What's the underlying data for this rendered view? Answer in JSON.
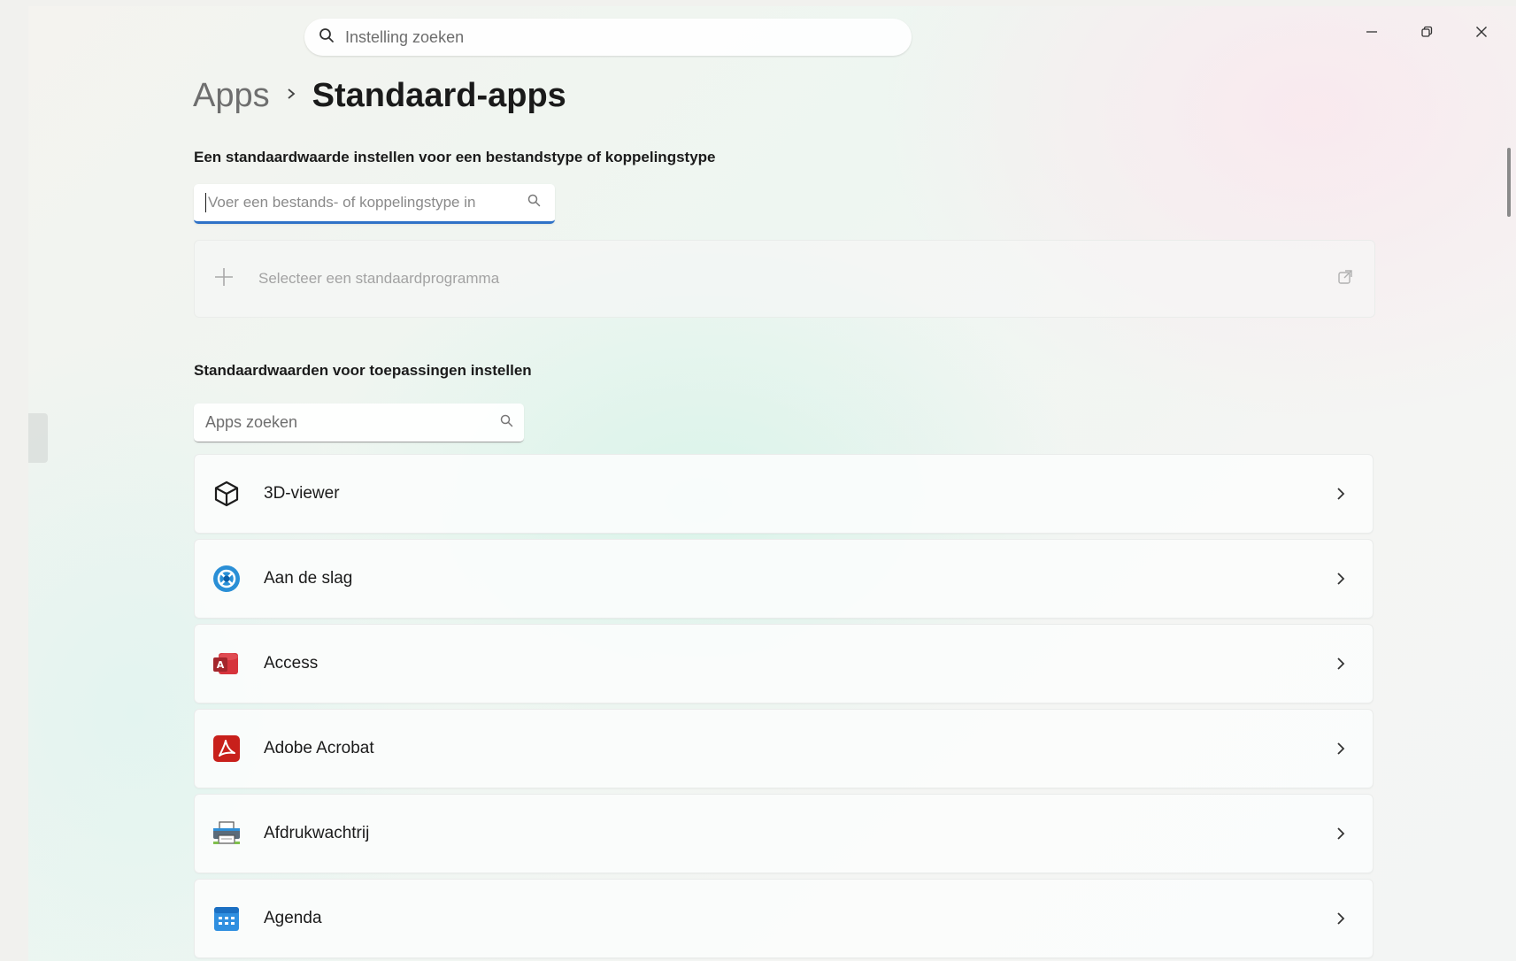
{
  "search": {
    "placeholder": "Instelling zoeken"
  },
  "breadcrumb": {
    "parent": "Apps",
    "separator": "›",
    "current": "Standaard-apps"
  },
  "filetype_section": {
    "title": "Een standaardwaarde instellen voor een bestandstype of koppelingstype",
    "input_placeholder": "Voer een bestands- of koppelingstype in",
    "add_label": "Selecteer een standaardprogramma"
  },
  "apps_section": {
    "title": "Standaardwaarden voor toepassingen instellen",
    "search_placeholder": "Apps zoeken",
    "items": [
      {
        "name": "3D-viewer",
        "icon": "cube-icon"
      },
      {
        "name": "Aan de slag",
        "icon": "get-started-icon"
      },
      {
        "name": "Access",
        "icon": "access-icon"
      },
      {
        "name": "Adobe Acrobat",
        "icon": "acrobat-icon"
      },
      {
        "name": "Afdrukwachtrij",
        "icon": "printer-icon"
      },
      {
        "name": "Agenda",
        "icon": "calendar-icon"
      }
    ]
  },
  "colors": {
    "accent": "#2f72c7",
    "acrobat": "#c8201b",
    "access": "#b4252e"
  }
}
